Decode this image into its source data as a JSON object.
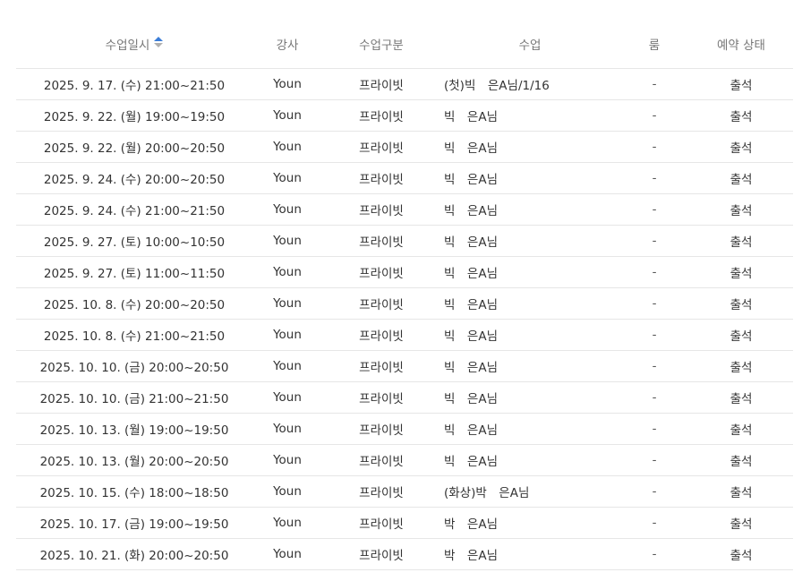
{
  "table": {
    "headers": {
      "date": "수업일시",
      "instructor": "강사",
      "type": "수업구분",
      "class": "수업",
      "room": "룸",
      "status": "예약 상태"
    },
    "sort_icon": "sort-asc-icon",
    "rows": [
      {
        "date": "2025. 9. 17. (수) 21:00~21:50",
        "instructor": "Youn",
        "type": "프라이빗",
        "class": "(첫)빅　은A님/1/16",
        "room": "-",
        "status": "출석"
      },
      {
        "date": "2025. 9. 22. (월) 19:00~19:50",
        "instructor": "Youn",
        "type": "프라이빗",
        "class": "빅　은A님",
        "room": "-",
        "status": "출석"
      },
      {
        "date": "2025. 9. 22. (월) 20:00~20:50",
        "instructor": "Youn",
        "type": "프라이빗",
        "class": "빅　은A님",
        "room": "-",
        "status": "출석"
      },
      {
        "date": "2025. 9. 24. (수) 20:00~20:50",
        "instructor": "Youn",
        "type": "프라이빗",
        "class": "빅　은A님",
        "room": "-",
        "status": "출석"
      },
      {
        "date": "2025. 9. 24. (수) 21:00~21:50",
        "instructor": "Youn",
        "type": "프라이빗",
        "class": "빅　은A님",
        "room": "-",
        "status": "출석"
      },
      {
        "date": "2025. 9. 27. (토) 10:00~10:50",
        "instructor": "Youn",
        "type": "프라이빗",
        "class": "빅　은A님",
        "room": "-",
        "status": "출석"
      },
      {
        "date": "2025. 9. 27. (토) 11:00~11:50",
        "instructor": "Youn",
        "type": "프라이빗",
        "class": "빅　은A님",
        "room": "-",
        "status": "출석"
      },
      {
        "date": "2025. 10. 8. (수) 20:00~20:50",
        "instructor": "Youn",
        "type": "프라이빗",
        "class": "빅　은A님",
        "room": "-",
        "status": "출석"
      },
      {
        "date": "2025. 10. 8. (수) 21:00~21:50",
        "instructor": "Youn",
        "type": "프라이빗",
        "class": "빅　은A님",
        "room": "-",
        "status": "출석"
      },
      {
        "date": "2025. 10. 10. (금) 20:00~20:50",
        "instructor": "Youn",
        "type": "프라이빗",
        "class": "빅　은A님",
        "room": "-",
        "status": "출석"
      },
      {
        "date": "2025. 10. 10. (금) 21:00~21:50",
        "instructor": "Youn",
        "type": "프라이빗",
        "class": "빅　은A님",
        "room": "-",
        "status": "출석"
      },
      {
        "date": "2025. 10. 13. (월) 19:00~19:50",
        "instructor": "Youn",
        "type": "프라이빗",
        "class": "빅　은A님",
        "room": "-",
        "status": "출석"
      },
      {
        "date": "2025. 10. 13. (월) 20:00~20:50",
        "instructor": "Youn",
        "type": "프라이빗",
        "class": "빅　은A님",
        "room": "-",
        "status": "출석"
      },
      {
        "date": "2025. 10. 15. (수) 18:00~18:50",
        "instructor": "Youn",
        "type": "프라이빗",
        "class": "(화상)박　은A님",
        "room": "-",
        "status": "출석"
      },
      {
        "date": "2025. 10. 17. (금) 19:00~19:50",
        "instructor": "Youn",
        "type": "프라이빗",
        "class": "박　은A님",
        "room": "-",
        "status": "출석"
      },
      {
        "date": "2025. 10. 21. (화) 20:00~20:50",
        "instructor": "Youn",
        "type": "프라이빗",
        "class": "박　은A님",
        "room": "-",
        "status": "출석"
      }
    ]
  },
  "colors": {
    "header_text": "#777777",
    "cell_text": "#333333",
    "divider": "#e6e6e6",
    "sort_active": "#3b7dd8",
    "sort_inactive": "#b0b0b0"
  }
}
